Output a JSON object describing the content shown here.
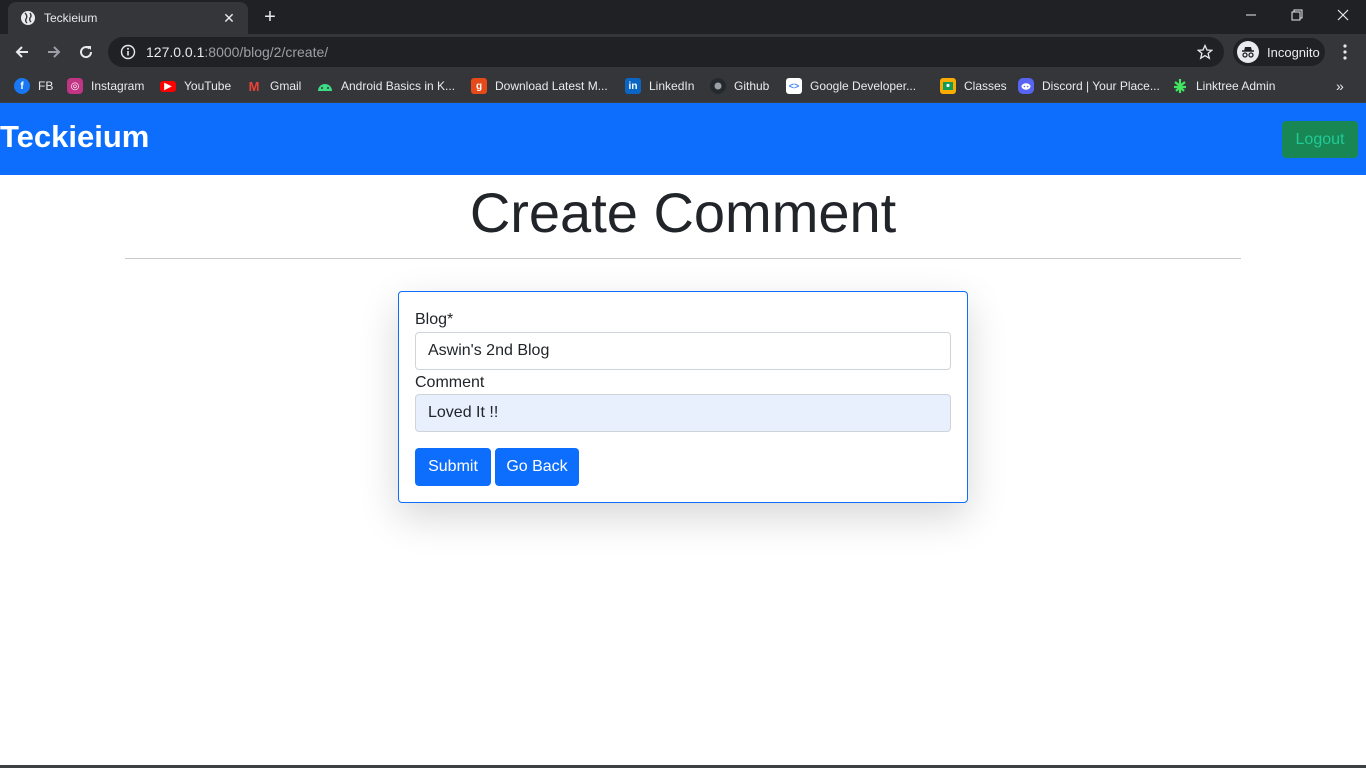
{
  "browser": {
    "tab_title": "Teckieium",
    "url_host": "127.0.0.1",
    "url_path": ":8000/blog/2/create/",
    "profile_label": "Incognito",
    "icons": {
      "favicon": "globe-icon",
      "close": "close-icon",
      "new_tab": "plus-icon",
      "back": "arrow-left-icon",
      "forward": "arrow-right-icon",
      "reload": "reload-icon",
      "info": "info-icon",
      "bookmark": "star-icon",
      "incognito": "incognito-icon",
      "menu": "kebab-menu-icon",
      "more_bookmarks": "chevron-double-right-icon"
    },
    "bookmarks": [
      {
        "label": "FB",
        "icon": "facebook-icon",
        "color": "#1877f2"
      },
      {
        "label": "Instagram",
        "icon": "instagram-icon",
        "color": "#c13584"
      },
      {
        "label": "YouTube",
        "icon": "youtube-icon",
        "color": "#ff0000"
      },
      {
        "label": "Gmail",
        "icon": "gmail-icon",
        "color": "#ea4335"
      },
      {
        "label": "Android Basics in K...",
        "icon": "android-icon",
        "color": "#3ddc84"
      },
      {
        "label": "Download Latest M...",
        "icon": "g-logo-icon",
        "color": "#e64a19"
      },
      {
        "label": "LinkedIn",
        "icon": "linkedin-icon",
        "color": "#0a66c2"
      },
      {
        "label": "Github",
        "icon": "github-icon",
        "color": "#24292e"
      },
      {
        "label": "Google Developer...",
        "icon": "google-developers-icon",
        "color": "#ffffff"
      },
      {
        "label": "Classes",
        "icon": "google-classroom-icon",
        "color": "#f9ab00"
      },
      {
        "label": "Discord | Your Place...",
        "icon": "discord-icon",
        "color": "#5865f2"
      },
      {
        "label": "Linktree Admin",
        "icon": "linktree-icon",
        "color": "#43e660"
      }
    ]
  },
  "page": {
    "brand": "Teckieium",
    "logout_label": "Logout",
    "heading": "Create Comment",
    "form": {
      "blog_label": "Blog*",
      "blog_value": "Aswin's 2nd Blog",
      "comment_label": "Comment",
      "comment_value": "Loved It !!",
      "submit_label": "Submit",
      "back_label": "Go Back"
    }
  },
  "colors": {
    "navbar": "#0d6efd",
    "logout_bg": "#198754",
    "logout_text": "#20c997",
    "button": "#0d6efd",
    "autofill": "#e8f0fe"
  }
}
